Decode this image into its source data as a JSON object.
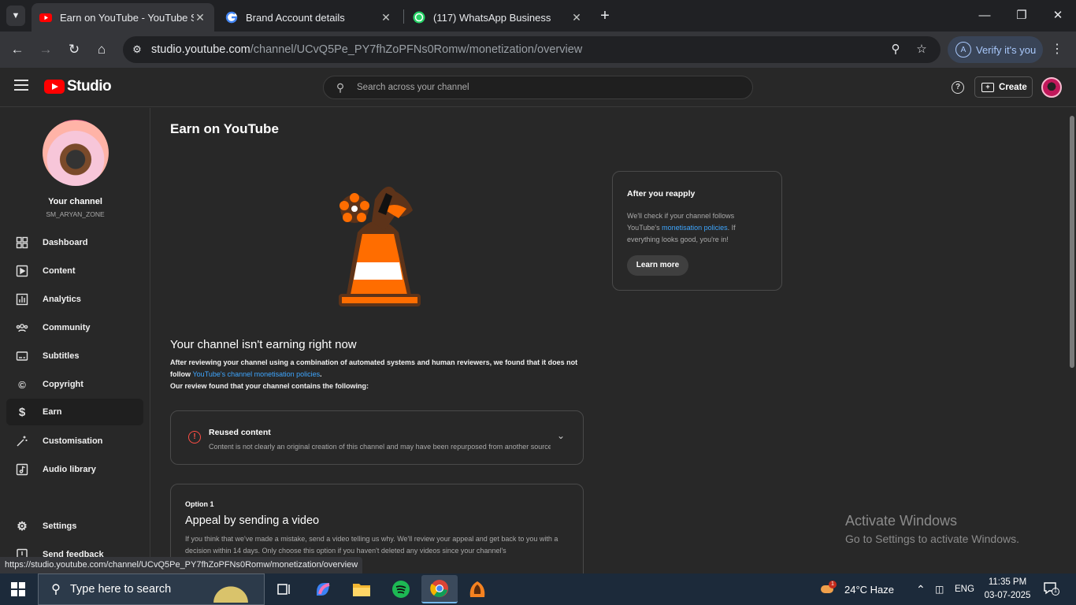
{
  "browser": {
    "tabs": [
      {
        "title": "Earn on YouTube - YouTube Studio",
        "active": true,
        "favicon": "youtube-icon"
      },
      {
        "title": "Brand Account details",
        "active": false,
        "favicon": "google-icon"
      },
      {
        "title": "(117) WhatsApp Business",
        "active": false,
        "favicon": "whatsapp-icon"
      }
    ],
    "url_host": "studio.youtube.com",
    "url_path": "/channel/UCvQ5Pe_PY7fhZoPFNs0Romw/monetization/overview",
    "verify_label": "Verify it's you",
    "verify_avatar": "A",
    "status_url": "https://studio.youtube.com/channel/UCvQ5Pe_PY7fhZoPFNs0Romw/monetization/overview"
  },
  "header": {
    "logo_text": "Studio",
    "search_placeholder": "Search across your channel",
    "create_label": "Create"
  },
  "sidebar": {
    "channel_label": "Your channel",
    "channel_handle": "SM_ARYAN_ZONE",
    "items": [
      {
        "label": "Dashboard",
        "icon": "dashboard-icon"
      },
      {
        "label": "Content",
        "icon": "content-icon"
      },
      {
        "label": "Analytics",
        "icon": "analytics-icon"
      },
      {
        "label": "Community",
        "icon": "community-icon"
      },
      {
        "label": "Subtitles",
        "icon": "subtitles-icon"
      },
      {
        "label": "Copyright",
        "icon": "copyright-icon"
      },
      {
        "label": "Earn",
        "icon": "dollar-icon",
        "active": true
      },
      {
        "label": "Customisation",
        "icon": "wand-icon"
      },
      {
        "label": "Audio library",
        "icon": "audio-library-icon"
      }
    ],
    "settings_label": "Settings",
    "feedback_label": "Send feedback"
  },
  "main": {
    "title": "Earn on YouTube",
    "status_title": "Your channel isn't earning right now",
    "status_text_1": "After reviewing your channel using a combination of automated systems and human reviewers, we found that it does not follow ",
    "status_link": "YouTube's channel monetisation policies",
    "status_text_2": ".",
    "status_text_3": "Our review found that your channel contains the following:",
    "issue": {
      "title": "Reused content",
      "description": "Content is not clearly an original creation of this channel and may have been repurposed from another source."
    },
    "option": {
      "kicker": "Option 1",
      "title": "Appeal by sending a video",
      "description": "If you think that we've made a mistake, send a video telling us why. We'll review your appeal and get back to you with a decision within 14 days. Only choose this option if you haven't deleted any videos since your channel's"
    },
    "side_card": {
      "title": "After you reapply",
      "text_1": "We'll check if your channel follows YouTube's ",
      "link": "monetisation policies",
      "text_2": ". If everything looks good, you're in!",
      "button": "Learn more"
    }
  },
  "watermark": {
    "line1": "Activate Windows",
    "line2": "Go to Settings to activate Windows."
  },
  "taskbar": {
    "search_placeholder": "Type here to search",
    "weather": "24°C  Haze",
    "weather_badge": "1",
    "lang": "ENG",
    "time": "11:35 PM",
    "date": "03-07-2025",
    "notification_count": "1"
  },
  "colors": {
    "accent_link": "#3ea6ff",
    "youtube_red": "#ff0000",
    "warning_red": "#ff4e45",
    "cone_orange": "#ff6d00"
  }
}
